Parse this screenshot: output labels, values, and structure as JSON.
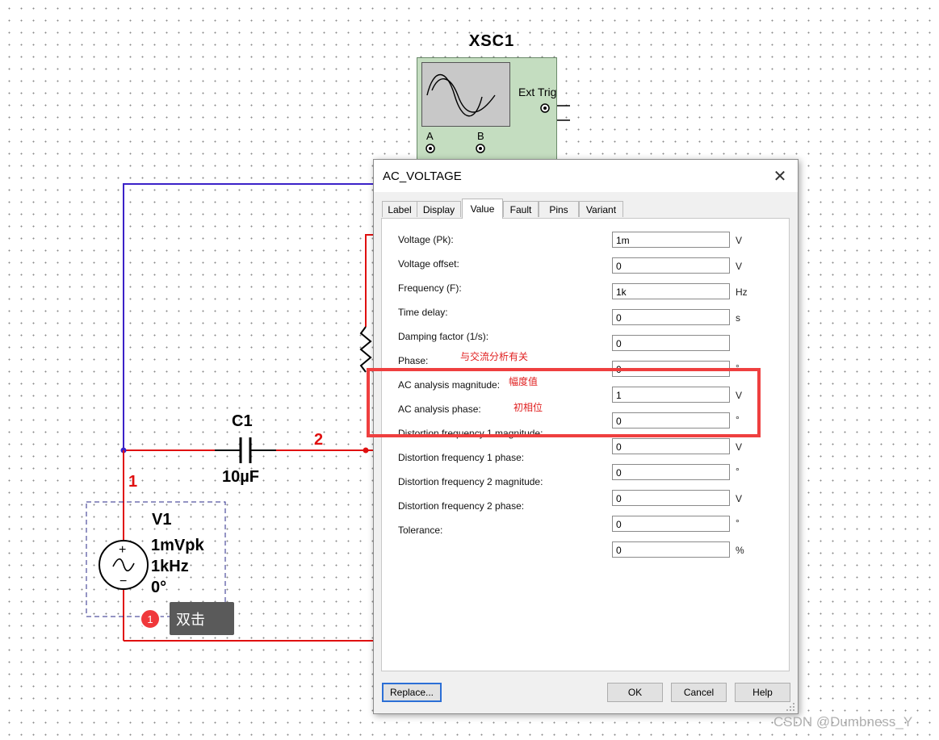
{
  "schematic": {
    "scope": {
      "title": "XSC1",
      "ext_trig_label": "Ext Trig",
      "channel_a": "A",
      "channel_b": "B"
    },
    "capacitor": {
      "name": "C1",
      "value": "10µF"
    },
    "source": {
      "name": "V1",
      "amplitude": "1mVpk",
      "frequency": "1kHz",
      "phase": "0°"
    },
    "nodes": {
      "n1": "1",
      "n2": "2"
    },
    "wire_colors": {
      "blue": "#3b22c8",
      "red": "#e01010"
    }
  },
  "dialog": {
    "title": "AC_VOLTAGE",
    "tabs": [
      "Label",
      "Display",
      "Value",
      "Fault",
      "Pins",
      "Variant"
    ],
    "active_tab": "Value",
    "params": [
      {
        "label": "Voltage (Pk):",
        "value": "1m",
        "unit": "V"
      },
      {
        "label": "Voltage offset:",
        "value": "0",
        "unit": "V"
      },
      {
        "label": "Frequency (F):",
        "value": "1k",
        "unit": "Hz"
      },
      {
        "label": "Time delay:",
        "value": "0",
        "unit": "s"
      },
      {
        "label": "Damping factor (1/s):",
        "value": "0",
        "unit": ""
      },
      {
        "label": "Phase:",
        "value": "0",
        "unit": "°"
      },
      {
        "label": "AC analysis magnitude:",
        "value": "1",
        "unit": "V"
      },
      {
        "label": "AC analysis phase:",
        "value": "0",
        "unit": "°"
      },
      {
        "label": "Distortion frequency 1 magnitude:",
        "value": "0",
        "unit": "V"
      },
      {
        "label": "Distortion frequency 1 phase:",
        "value": "0",
        "unit": "°"
      },
      {
        "label": "Distortion frequency 2 magnitude:",
        "value": "0",
        "unit": "V"
      },
      {
        "label": "Distortion frequency 2 phase:",
        "value": "0",
        "unit": "°"
      },
      {
        "label": "Tolerance:",
        "value": "0",
        "unit": "%"
      }
    ],
    "buttons": {
      "replace": "Replace...",
      "ok": "OK",
      "cancel": "Cancel",
      "help": "Help"
    }
  },
  "annotations": {
    "ac_related": "与交流分析有关",
    "magnitude": "幅度值",
    "initial_phase": "初相位",
    "highlight_color": "#ef3f3f"
  },
  "tooltip": {
    "step": "1",
    "text": "双击"
  },
  "watermark": "CSDN @Dumbness_Y"
}
